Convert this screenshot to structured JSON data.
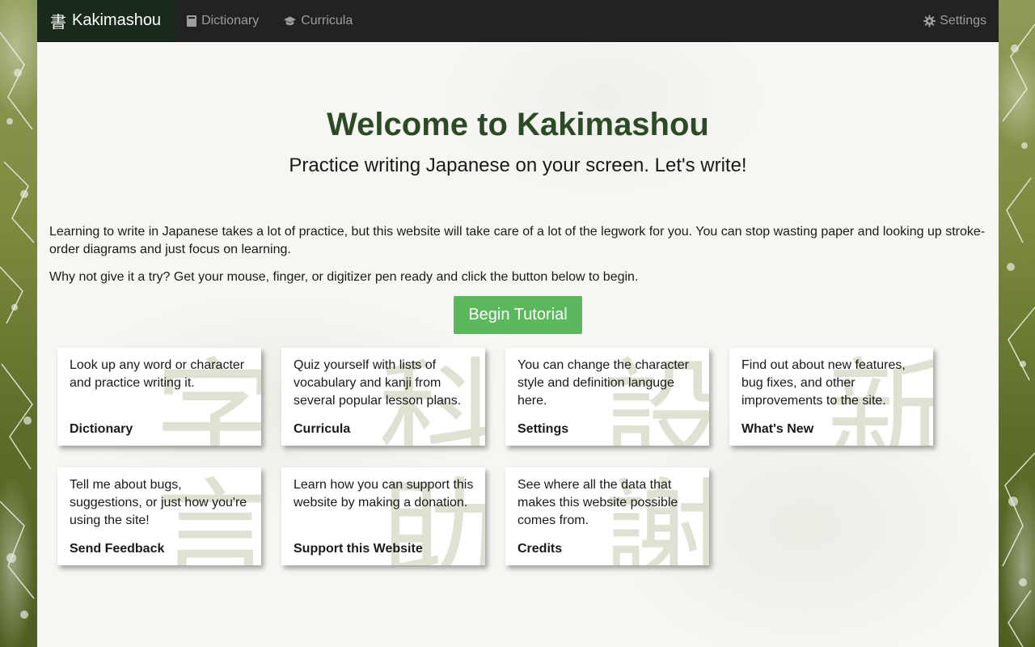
{
  "navbar": {
    "brand_icon": "書",
    "brand": "Kakimashou",
    "items": [
      {
        "label": "Dictionary",
        "icon": "book-icon"
      },
      {
        "label": "Curricula",
        "icon": "graduation-cap-icon"
      }
    ],
    "settings": {
      "label": "Settings",
      "icon": "gear-icon"
    }
  },
  "hero": {
    "title": "Welcome to Kakimashou",
    "subtitle": "Practice writing Japanese on your screen. Let's write!"
  },
  "intro": {
    "paragraph1": "Learning to write in Japanese takes a lot of practice, but this website will take care of a lot of the legwork for you. You can stop wasting paper and looking up stroke-order diagrams and just focus on learning.",
    "paragraph2": "Why not give it a try? Get your mouse, finger, or digitizer pen ready and click the button below to begin."
  },
  "cta": {
    "label": "Begin Tutorial"
  },
  "cards": [
    {
      "desc": "Look up any word or character and practice writing it.",
      "title": "Dictionary",
      "kanji": "字"
    },
    {
      "desc": "Quiz yourself with lists of vocabulary and kanji from several popular lesson plans.",
      "title": "Curricula",
      "kanji": "科"
    },
    {
      "desc": "You can change the character style and definition languge here.",
      "title": "Settings",
      "kanji": "設"
    },
    {
      "desc": "Find out about new features, bug fixes, and other improvements to the site.",
      "title": "What's New",
      "kanji": "新"
    },
    {
      "desc": "Tell me about bugs, suggestions, or just how you're using the site!",
      "title": "Send Feedback",
      "kanji": "言"
    },
    {
      "desc": "Learn how you can support this website by making a donation.",
      "title": "Support this Website",
      "kanji": "助"
    },
    {
      "desc": "See where all the data that makes this website possible comes from.",
      "title": "Credits",
      "kanji": "謝"
    }
  ],
  "colors": {
    "navbar_bg": "#222222",
    "brand_bg": "#1a2a1a",
    "title_green": "#2d4a27",
    "button_green": "#5cb85c"
  }
}
